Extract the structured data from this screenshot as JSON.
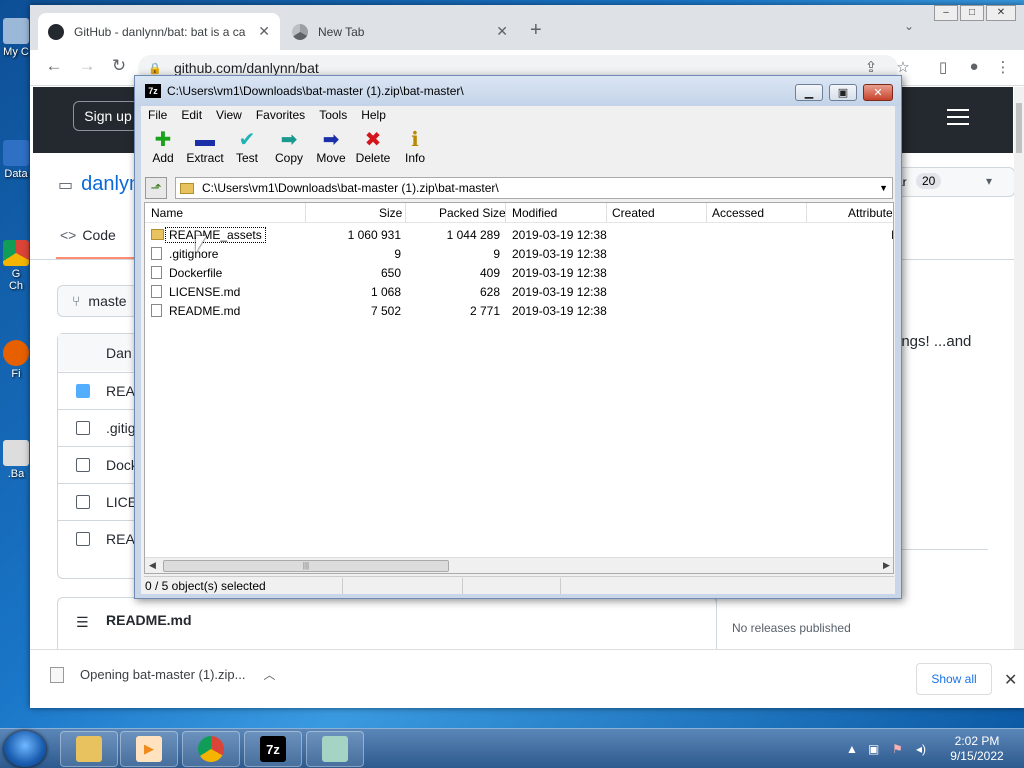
{
  "desktop": {
    "icons": [
      {
        "label": "My C",
        "name": "my-computer"
      },
      {
        "label": "Data",
        "name": "data-folder"
      },
      {
        "label": "G\nCh",
        "name": "google-chrome"
      },
      {
        "label": "Fi",
        "name": "firefox"
      },
      {
        "label": ".Ba",
        "name": "bat-file"
      }
    ]
  },
  "chrome": {
    "tabs": [
      {
        "title": "GitHub - danlynn/bat: bat is a ca",
        "active": true
      },
      {
        "title": "New Tab",
        "active": false
      }
    ],
    "url": "github.com/danlynn/bat"
  },
  "github": {
    "signup": "Sign up",
    "repo": "danlyn",
    "star_label": "ar",
    "star_count": "20",
    "tab_code": "Code",
    "branch": "maste",
    "files_header": "Dan",
    "files": [
      {
        "name": "READ",
        "type": "folder"
      },
      {
        "name": ".gitig",
        "type": "file"
      },
      {
        "name": "Dock",
        "type": "file"
      },
      {
        "name": "LICEI",
        "type": "file"
      },
      {
        "name": "READ",
        "type": "file"
      }
    ],
    "description_fragment": "ings! ...and",
    "readme_label": "README.md",
    "releases": "No releases published"
  },
  "download_bar": {
    "item": "Opening bat-master (1).zip...",
    "show_all": "Show all"
  },
  "sevenzip": {
    "title": "C:\\Users\\vm1\\Downloads\\bat-master (1).zip\\bat-master\\",
    "logo": "7z",
    "menu": [
      "File",
      "Edit",
      "View",
      "Favorites",
      "Tools",
      "Help"
    ],
    "tools": [
      {
        "label": "Add",
        "glyph": "✚",
        "color": "#1aa31a"
      },
      {
        "label": "Extract",
        "glyph": "▬",
        "color": "#1b2fa8"
      },
      {
        "label": "Test",
        "glyph": "✔",
        "color": "#1fb5b5"
      },
      {
        "label": "Copy",
        "glyph": "➡",
        "color": "#1a9a8f"
      },
      {
        "label": "Move",
        "glyph": "➡",
        "color": "#1b2fa8"
      },
      {
        "label": "Delete",
        "glyph": "✖",
        "color": "#d4161c"
      },
      {
        "label": "Info",
        "glyph": "ℹ",
        "color": "#b98a00"
      }
    ],
    "path": "C:\\Users\\vm1\\Downloads\\bat-master (1).zip\\bat-master\\",
    "columns": [
      "Name",
      "Size",
      "Packed Size",
      "Modified",
      "Created",
      "Accessed",
      "Attribute"
    ],
    "rows": [
      {
        "name": "README_assets",
        "size": "1 060 931",
        "packed": "1 044 289",
        "modified": "2019-03-19 12:38",
        "type": "folder",
        "attr": "I"
      },
      {
        "name": ".gitignore",
        "size": "9",
        "packed": "9",
        "modified": "2019-03-19 12:38",
        "type": "file",
        "attr": ""
      },
      {
        "name": "Dockerfile",
        "size": "650",
        "packed": "409",
        "modified": "2019-03-19 12:38",
        "type": "file",
        "attr": ""
      },
      {
        "name": "LICENSE.md",
        "size": "1 068",
        "packed": "628",
        "modified": "2019-03-19 12:38",
        "type": "file",
        "attr": ""
      },
      {
        "name": "README.md",
        "size": "7 502",
        "packed": "2 771",
        "modified": "2019-03-19 12:38",
        "type": "file",
        "attr": ""
      }
    ],
    "status": "0 / 5 object(s) selected"
  },
  "taskbar": {
    "apps": [
      {
        "name": "explorer",
        "glyph": "",
        "color": "#e8c25e"
      },
      {
        "name": "media-player",
        "glyph": "▶",
        "color": "#f08a1c"
      },
      {
        "name": "chrome",
        "glyph": "",
        "color": "#db4437"
      },
      {
        "name": "7zip",
        "glyph": "7z",
        "color": "#ffffff"
      },
      {
        "name": "notepad",
        "glyph": "",
        "color": "#a6d4c4"
      }
    ],
    "time": "2:02 PM",
    "date": "9/15/2022"
  }
}
